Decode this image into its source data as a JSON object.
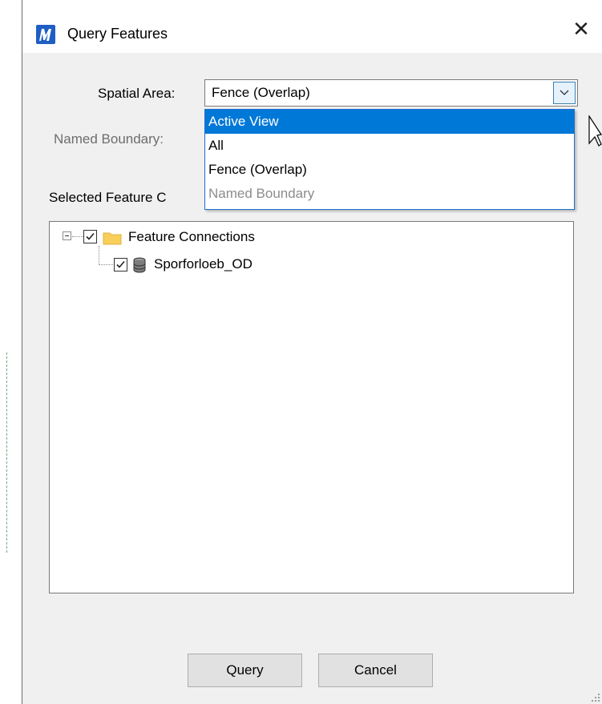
{
  "window": {
    "title": "Query Features",
    "close_glyph": "✕",
    "icon": "microstation-logo-icon"
  },
  "spatial_area": {
    "label": "Spatial Area:",
    "value": "Fence (Overlap)",
    "options": [
      "Active View",
      "All",
      "Fence (Overlap)",
      "Named Boundary"
    ],
    "highlighted_option": "Active View",
    "disabled_option": "Named Boundary"
  },
  "named_boundary": {
    "label": "Named Boundary:"
  },
  "selected_feature_connections": {
    "label": "Selected Feature C",
    "tree": {
      "root": {
        "label": "Feature Connections",
        "checked": true,
        "expanded": true,
        "icon": "folder-icon"
      },
      "children": [
        {
          "label": "Sporforloeb_OD",
          "checked": true,
          "icon": "database-icon"
        }
      ]
    }
  },
  "buttons": {
    "query": "Query",
    "cancel": "Cancel"
  },
  "colors": {
    "accent": "#0078d7",
    "app_icon": "#1e5ec5",
    "dialog_bg": "#f0f0f0",
    "folder": "#f7cf5a",
    "disabled_text": "#8c8c8c"
  }
}
